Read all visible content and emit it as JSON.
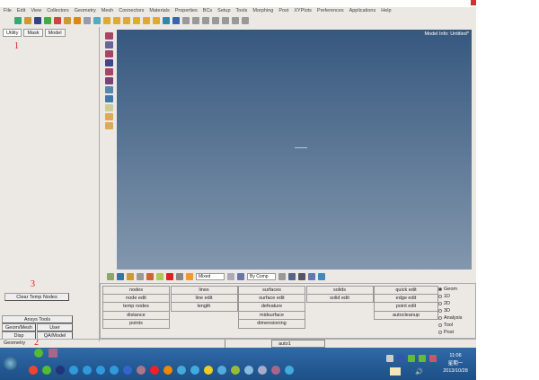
{
  "menu": [
    "File",
    "Edit",
    "View",
    "Collectors",
    "Geometry",
    "Mesh",
    "Connectors",
    "Materials",
    "Properties",
    "BCs",
    "Setup",
    "Tools",
    "Morphing",
    "Post",
    "XYPlots",
    "Preferences",
    "Applications",
    "Help"
  ],
  "left_panel": {
    "tabs": [
      "Utility",
      "Mask",
      "Model"
    ],
    "clear_temp_nodes": "Clear Temp Nodes",
    "ansys_tools": "Ansys Tools",
    "buttons": [
      "Geom/Mesh",
      "User",
      "Disp",
      "QA/Model"
    ],
    "footer": "Geometry"
  },
  "annotations": [
    "1",
    "3",
    "2"
  ],
  "graphics": {
    "model_info": "Model Info: Untitled*",
    "accent": "#36587f"
  },
  "bottom_toolbar": {
    "display_mode": "Mixed",
    "color_mode": "By Comp"
  },
  "panel": {
    "columns": [
      [
        "nodes",
        "node edit",
        "temp nodes",
        "distance",
        "points"
      ],
      [
        "lines",
        "line edit",
        "length"
      ],
      [
        "surfaces",
        "surface edit",
        "defeature",
        "midsurface",
        "dimensioning"
      ],
      [
        "solids",
        "solid edit"
      ],
      [
        "quick edit",
        "edge edit",
        "point edit",
        "autocleanup"
      ]
    ],
    "radios": [
      "Geom",
      "1D",
      "2D",
      "3D",
      "Analysis",
      "Tool",
      "Post"
    ],
    "selected_radio": "Geom"
  },
  "status": {
    "component": "auto1"
  },
  "taskbar": {
    "time": "11:06",
    "weekday": "星期一",
    "date": "2013/10/28"
  }
}
